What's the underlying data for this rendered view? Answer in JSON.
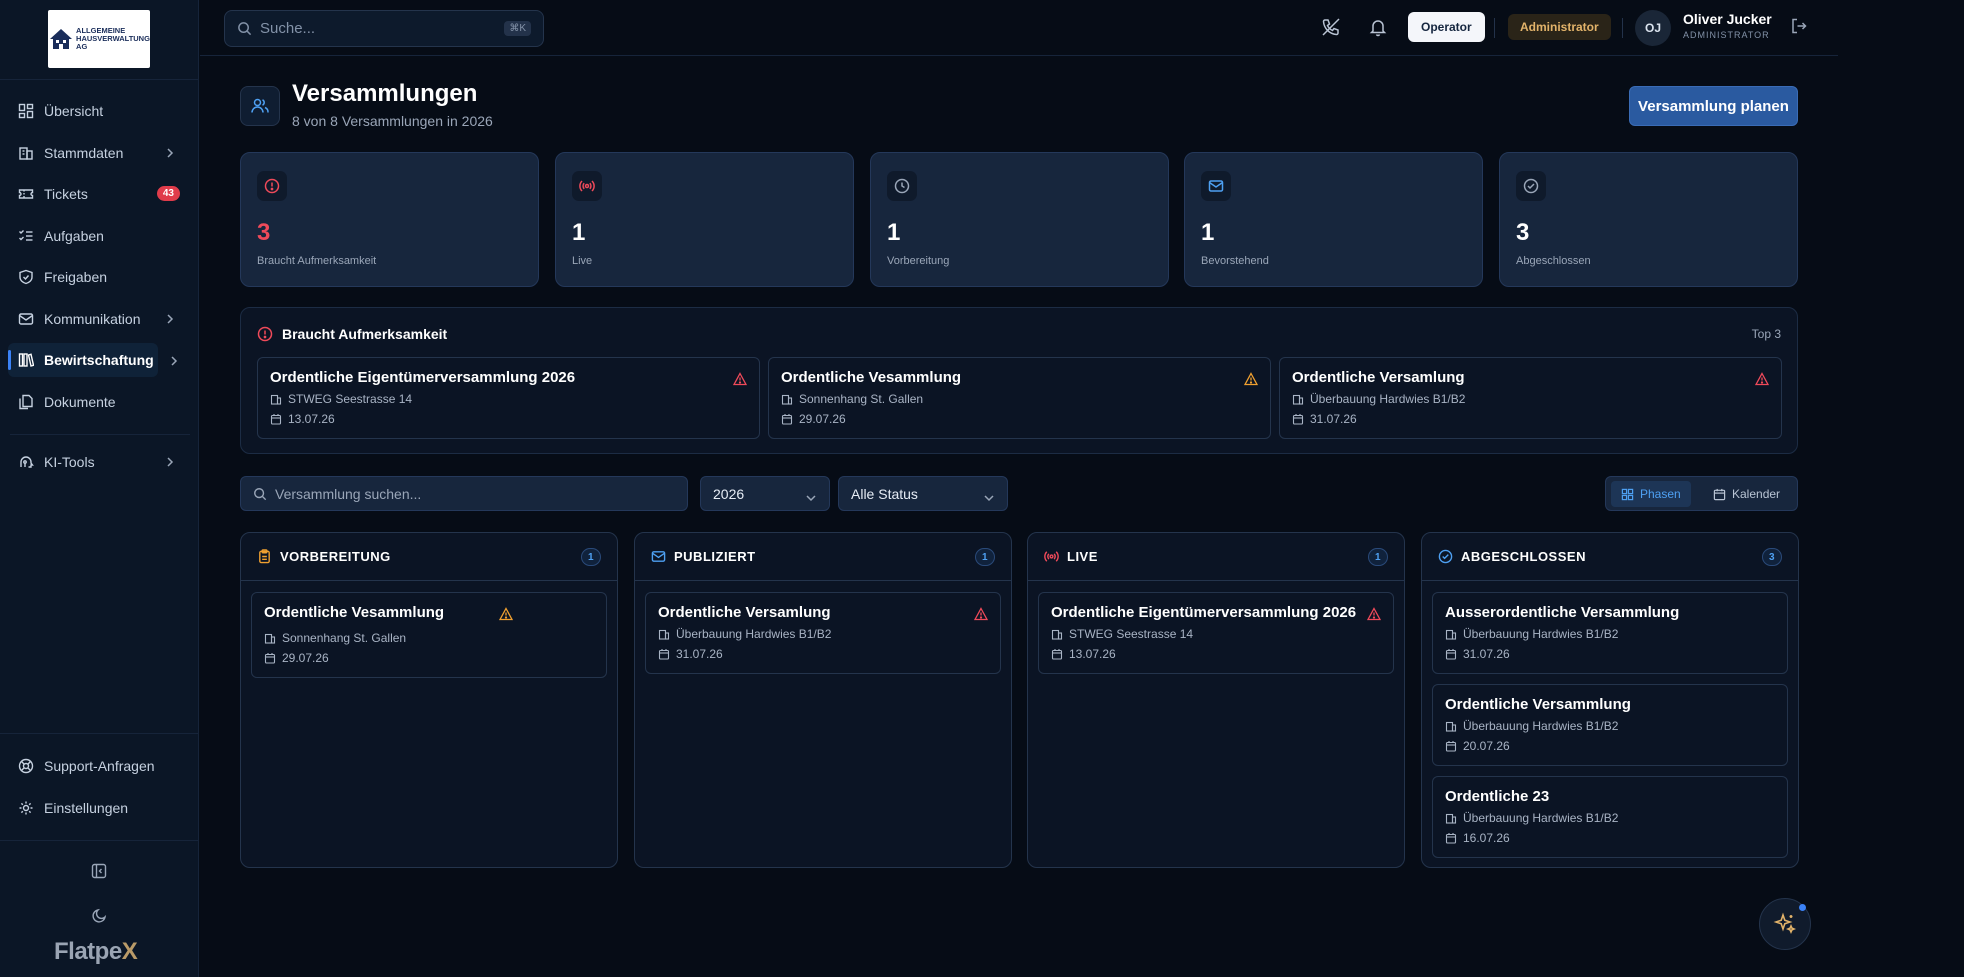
{
  "sidebar": {
    "logo": {
      "line1": "ALLGEMEINE",
      "line2": "HAUSVERWALTUNG",
      "line3": "AG"
    },
    "items": [
      {
        "label": "Übersicht",
        "icon": "dashboard-icon"
      },
      {
        "label": "Stammdaten",
        "icon": "building-icon"
      },
      {
        "label": "Tickets",
        "icon": "ticket-icon",
        "badge": "43"
      },
      {
        "label": "Aufgaben",
        "icon": "list-check-icon"
      },
      {
        "label": "Freigaben",
        "icon": "shield-check-icon"
      },
      {
        "label": "Kommunikation",
        "icon": "mail-icon"
      },
      {
        "label": "Bewirtschaftung",
        "icon": "library-icon"
      },
      {
        "label": "Dokumente",
        "icon": "documents-icon"
      },
      {
        "label": "KI-Tools",
        "icon": "ai-brain-icon"
      }
    ],
    "bottom": [
      {
        "label": "Support-Anfragen",
        "icon": "support-icon"
      },
      {
        "label": "Einstellungen",
        "icon": "gear-icon"
      }
    ],
    "brand_a": "Flatpe",
    "brand_b": "X"
  },
  "topbar": {
    "search_placeholder": "Suche...",
    "search_kbd": "⌘K",
    "operator_label": "Operator",
    "role_pill": "Administrator",
    "avatar_initials": "OJ",
    "user_name": "Oliver Jucker",
    "user_role": "ADMINISTRATOR"
  },
  "header": {
    "title": "Versammlungen",
    "subtitle": "8 von 8 Versammlungen in 2026",
    "primary_button": "Versammlung planen"
  },
  "stats": [
    {
      "value": "3",
      "label": "Braucht Aufmerksamkeit",
      "icon": "alert-circle-icon",
      "color": "#ef4a5a"
    },
    {
      "value": "1",
      "label": "Live",
      "icon": "broadcast-icon",
      "color": "#ef4a5a"
    },
    {
      "value": "1",
      "label": "Vorbereitung",
      "icon": "clock-icon",
      "color": "#9aa6b8"
    },
    {
      "value": "1",
      "label": "Bevorstehend",
      "icon": "mail-icon",
      "color": "#4ea0f2"
    },
    {
      "value": "3",
      "label": "Abgeschlossen",
      "icon": "check-circle-icon",
      "color": "#9aa6b8"
    }
  ],
  "attention": {
    "title": "Braucht Aufmerksamkeit",
    "top_label": "Top 3",
    "cards": [
      {
        "title": "Ordentliche Eigentümerversammlung 2026",
        "property": "STWEG Seestrasse 14",
        "date": "13.07.26",
        "warn_color": "#ef4a5a"
      },
      {
        "title": "Ordentliche Vesammlung",
        "property": "Sonnenhang St. Gallen",
        "date": "29.07.26",
        "warn_color": "#f0a030"
      },
      {
        "title": "Ordentliche Versamlung",
        "property": "Überbauung Hardwies B1/B2",
        "date": "31.07.26",
        "warn_color": "#ef4a5a"
      }
    ]
  },
  "filters": {
    "search_placeholder": "Versammlung suchen...",
    "year": "2026",
    "status": "Alle Status",
    "view_phases": "Phasen",
    "view_calendar": "Kalender"
  },
  "columns": [
    {
      "title": "VORBEREITUNG",
      "count": "1",
      "icon": "clipboard-icon",
      "icon_color": "#f0a030",
      "cards": [
        {
          "title": "Ordentliche Vesammlung",
          "property": "Sonnenhang St. Gallen",
          "date": "29.07.26",
          "warn": "#f0a030"
        }
      ]
    },
    {
      "title": "PUBLIZIERT",
      "count": "1",
      "icon": "mail-icon",
      "icon_color": "#4ea0f2",
      "cards": [
        {
          "title": "Ordentliche Versamlung",
          "property": "Überbauung Hardwies B1/B2",
          "date": "31.07.26",
          "warn": "#ef4a5a"
        }
      ]
    },
    {
      "title": "LIVE",
      "count": "1",
      "icon": "broadcast-icon",
      "icon_color": "#ef4a5a",
      "cards": [
        {
          "title": "Ordentliche Eigentümerversammlung 2026",
          "property": "STWEG Seestrasse 14",
          "date": "13.07.26",
          "warn": "#ef4a5a"
        }
      ]
    },
    {
      "title": "ABGESCHLOSSEN",
      "count": "3",
      "icon": "check-circle-icon",
      "icon_color": "#4ea0f2",
      "cards": [
        {
          "title": "Ausserordentliche Versammlung",
          "property": "Überbauung Hardwies B1/B2",
          "date": "31.07.26"
        },
        {
          "title": "Ordentliche Versammlung",
          "property": "Überbauung Hardwies B1/B2",
          "date": "20.07.26"
        },
        {
          "title": "Ordentliche 23",
          "property": "Überbauung Hardwies B1/B2",
          "date": "16.07.26"
        }
      ]
    }
  ]
}
